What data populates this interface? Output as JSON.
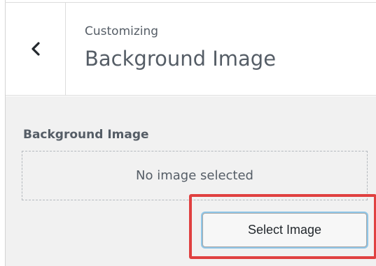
{
  "header": {
    "back_icon": "chevron-left-icon",
    "back_label": "Back",
    "context_label": "Customizing",
    "title": "Background Image"
  },
  "control": {
    "title": "Background Image",
    "placeholder": "No image selected",
    "select_button_label": "Select Image"
  },
  "colors": {
    "text": "#555d66",
    "panel_bg": "#f1f1f1",
    "highlight": "#e04040",
    "button_focus_ring": "#8fc6e8"
  }
}
